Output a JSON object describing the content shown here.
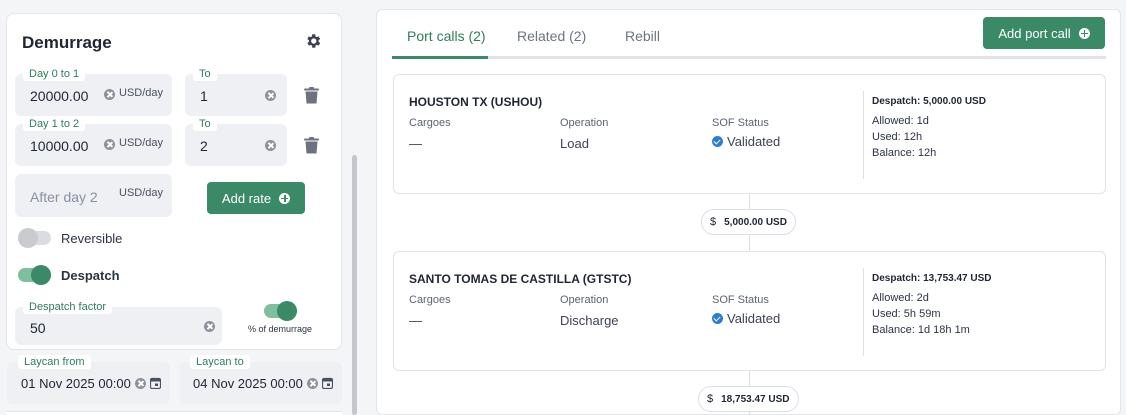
{
  "demurrage": {
    "title": "Demurrage",
    "rates": [
      {
        "day_label": "Day 0 to 1",
        "value": "20000.00",
        "unit": "USD/day",
        "to_label": "To",
        "to_value": "1"
      },
      {
        "day_label": "Day 1 to 2",
        "value": "10000.00",
        "unit": "USD/day",
        "to_label": "To",
        "to_value": "2"
      }
    ],
    "after": {
      "placeholder": "After day 2",
      "unit": "USD/day"
    },
    "add_rate_label": "Add rate",
    "reversible_label": "Reversible",
    "reversible_on": false,
    "despatch_label": "Despatch",
    "despatch_on": true,
    "despatch_factor_label": "Despatch factor",
    "despatch_factor_value": "50",
    "pct_label": "% of demurrage",
    "pct_on": true
  },
  "laycan": {
    "from_label": "Laycan from",
    "from_value": "01 Nov 2025 00:00",
    "to_label": "Laycan to",
    "to_value": "04 Nov 2025 00:00"
  },
  "tabs": [
    {
      "label": "Port calls (2)",
      "active": true
    },
    {
      "label": "Related (2)",
      "active": false
    },
    {
      "label": "Rebill",
      "active": false
    }
  ],
  "add_port_call_label": "Add port call",
  "column_labels": {
    "cargoes": "Cargoes",
    "operation": "Operation",
    "sof_status": "SOF Status"
  },
  "port_calls": [
    {
      "name": "HOUSTON TX (USHOU)",
      "cargoes": "—",
      "operation": "Load",
      "sof_status": "Validated",
      "despatch": "Despatch: 5,000.00 USD",
      "allowed": "Allowed: 1d",
      "used": "Used: 12h",
      "balance": "Balance: 12h"
    },
    {
      "name": "SANTO TOMAS DE CASTILLA (GTSTC)",
      "cargoes": "—",
      "operation": "Discharge",
      "sof_status": "Validated",
      "despatch": "Despatch: 13,753.47 USD",
      "allowed": "Allowed: 2d",
      "used": "Used: 5h 59m",
      "balance": "Balance: 1d 18h 1m"
    }
  ],
  "totals": [
    {
      "currency_symbol": "$",
      "amount": "5,000.00 USD"
    },
    {
      "currency_symbol": "$",
      "amount": "18,753.47 USD"
    }
  ],
  "colors": {
    "accent": "#3a8a67",
    "check": "#2f7bd6"
  }
}
